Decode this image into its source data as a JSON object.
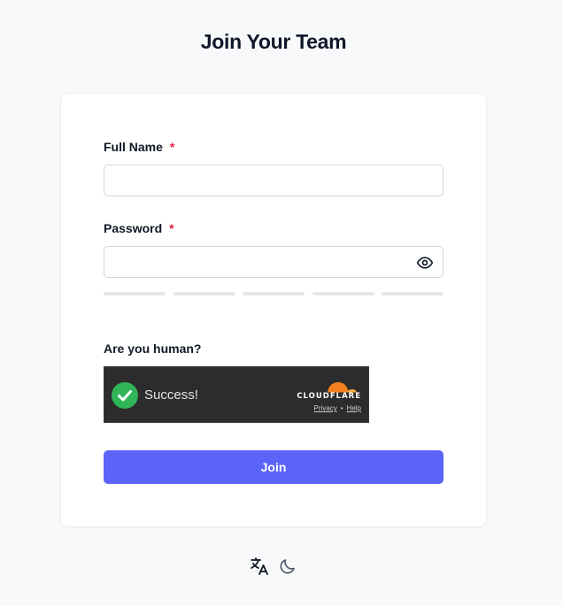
{
  "page": {
    "title": "Join Your Team"
  },
  "form": {
    "full_name": {
      "label": "Full Name",
      "required_mark": "*",
      "value": "",
      "placeholder": ""
    },
    "password": {
      "label": "Password",
      "required_mark": "*",
      "value": "",
      "placeholder": "",
      "toggle_icon": "eye-icon",
      "strength_segments": 5,
      "strength_level": 0
    },
    "captcha": {
      "label": "Are you human?",
      "status_text": "Success!",
      "brand": "CLOUDFLARE",
      "privacy_link": "Privacy",
      "separator": "•",
      "help_link": "Help"
    },
    "submit_label": "Join"
  },
  "footer": {
    "language_icon": "translate-icon",
    "theme_icon": "moon-icon"
  },
  "colors": {
    "background": "#f8f9fb",
    "accent": "#5b63f8",
    "required": "#e11d48",
    "success": "#2fb457",
    "cloudflare_orange": "#f38020"
  }
}
